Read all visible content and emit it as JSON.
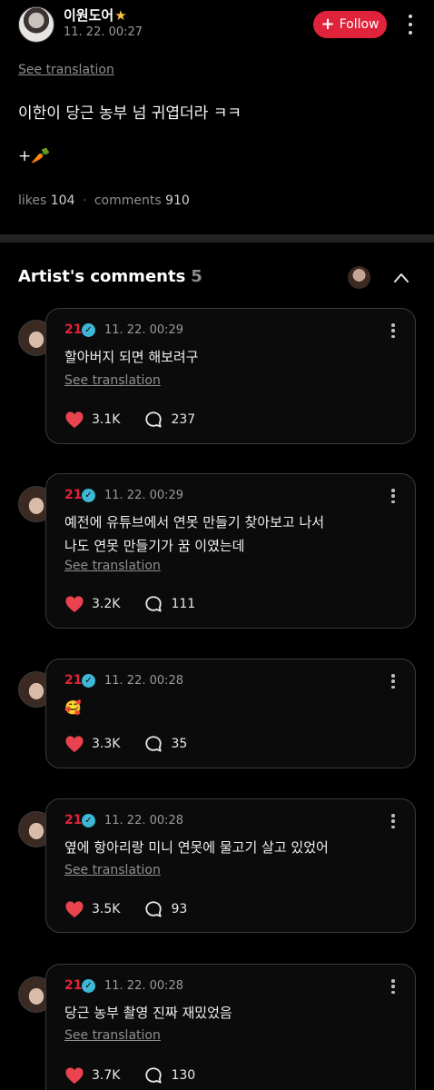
{
  "post": {
    "author": "이원도어",
    "star": "★",
    "time": "11. 22. 00:27",
    "follow_label": "Follow",
    "follow_plus": "+",
    "translate_label": "See translation",
    "text": "이한이 당근 농부 넘 귀엽더라 ㅋㅋ",
    "emoji_line": "+🥕",
    "likes_label": "likes",
    "likes_count": "104",
    "comments_label": "comments",
    "comments_count": "910",
    "sep": "·"
  },
  "artist_comments": {
    "title": "Artist's comments",
    "count": "5"
  },
  "comments": [
    {
      "author": "21",
      "time": "11. 22. 00:29",
      "text": "할아버지 되면 해보려구",
      "translate_label": "See translation",
      "likes": "3.1K",
      "replies": "237"
    },
    {
      "author": "21",
      "time": "11. 22. 00:29",
      "text": "예전에 유튜브에서 연못 만들기 찾아보고 나서\n나도 연못 만들기가 꿈 이였는데",
      "translate_label": "See translation",
      "likes": "3.2K",
      "replies": "111"
    },
    {
      "author": "21",
      "time": "11. 22. 00:28",
      "text": "🥰",
      "likes": "3.3K",
      "replies": "35"
    },
    {
      "author": "21",
      "time": "11. 22. 00:28",
      "text": "옆에 항아리랑 미니 연못에 물고기 살고 있었어",
      "translate_label": "See translation",
      "likes": "3.5K",
      "replies": "93"
    },
    {
      "author": "21",
      "time": "11. 22. 00:28",
      "text": "당근 농부 촬영 진짜 재밌었음",
      "translate_label": "See translation",
      "likes": "3.7K",
      "replies": "130"
    }
  ],
  "colors": {
    "accent": "#e0233b",
    "verified": "#3fb7d6",
    "heart": "#e8434f",
    "background": "#000000"
  },
  "icons": {
    "heart": "heart-icon",
    "reply": "speech-bubble-icon",
    "more": "more-vertical-icon",
    "collapse": "chevron-up-icon",
    "verified": "verified-badge-icon"
  }
}
